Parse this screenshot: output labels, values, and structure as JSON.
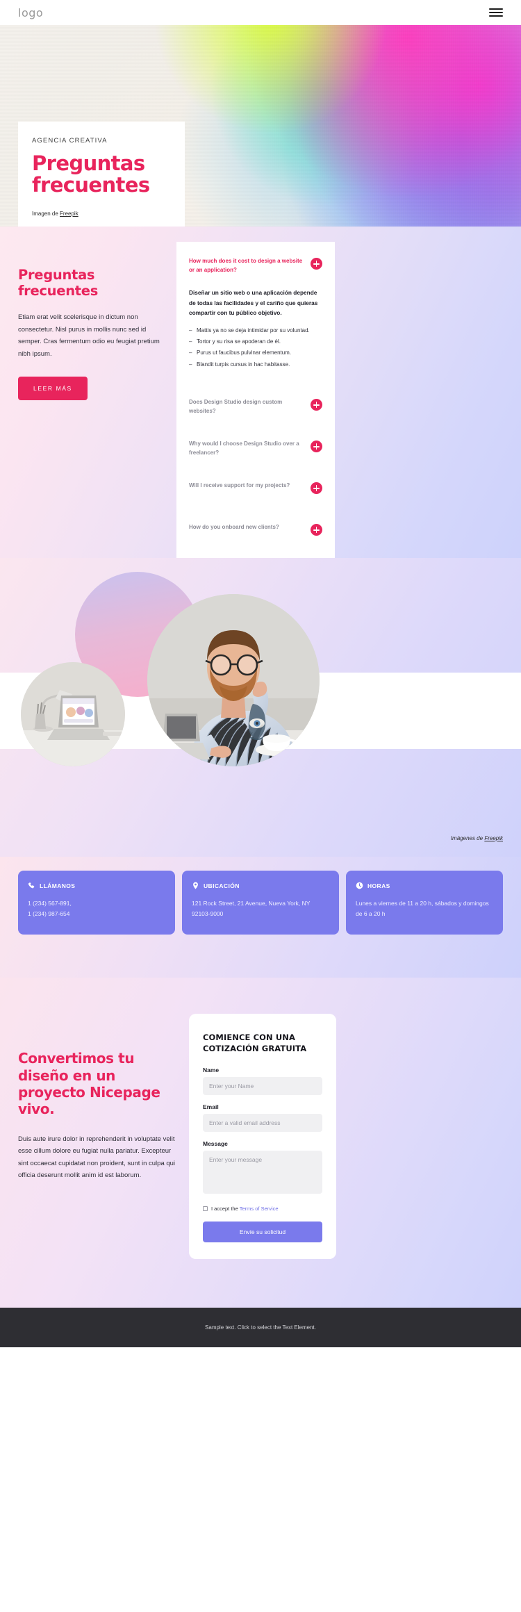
{
  "header": {
    "logo": "logo",
    "menu_icon": "hamburger-menu-icon"
  },
  "hero": {
    "eyebrow": "AGENCIA CREATIVA",
    "title_line1": "Preguntas",
    "title_line2": "frecuentes",
    "credit_prefix": "Imagen de ",
    "credit_link": "Freepik"
  },
  "faq": {
    "heading": "Preguntas frecuentes",
    "lead": "Etiam erat velit scelerisque in dictum non consectetur. Nisl purus in mollis nunc sed id semper. Cras fermentum odio eu feugiat pretium nibh ipsum.",
    "cta_label": "LEER MÁS",
    "items": [
      {
        "question": "How much does it cost to design a website or an application?",
        "open": true,
        "answer_lead": "Diseñar un sitio web o una aplicación depende de todas las facilidades y el cariño que quieras compartir con tu público objetivo.",
        "bullets": [
          "Mattis ya no se deja intimidar por su voluntad.",
          "Tortor y su risa se apoderan de él.",
          "Purus ut faucibus pulvinar elementum.",
          "Blandit turpis cursus in hac habitasse."
        ]
      },
      {
        "question": "Does Design Studio design custom websites?",
        "open": false
      },
      {
        "question": "Why would I choose Design Studio over a freelancer?",
        "open": false
      },
      {
        "question": "Will I receive support for my projects?",
        "open": false
      },
      {
        "question": "How do you onboard new clients?",
        "open": false
      }
    ]
  },
  "photos": {
    "credit_prefix": "Imágenes de ",
    "credit_link": "Freepik"
  },
  "contact": {
    "cards": [
      {
        "icon": "phone-icon",
        "title": "LLÁMANOS",
        "body": "1 (234) 567-891,\n1 (234) 987-654"
      },
      {
        "icon": "location-pin-icon",
        "title": "UBICACIÓN",
        "body": "121 Rock Street, 21 Avenue, Nueva York, NY 92103-9000"
      },
      {
        "icon": "clock-icon",
        "title": "HORAS",
        "body": "Lunes a viernes de 11 a 20 h, sábados y domingos de 6 a 20 h"
      }
    ]
  },
  "cta": {
    "title": "Convertimos tu diseño en un proyecto Nicepage vivo.",
    "text": "Duis aute irure dolor in reprehenderit in voluptate velit esse cillum dolore eu fugiat nulla pariatur. Excepteur sint occaecat cupidatat non proident, sunt in culpa qui officia deserunt mollit anim id est laborum."
  },
  "form": {
    "title": "COMIENCE CON UNA COTIZACIÓN GRATUITA",
    "name_label": "Name",
    "name_placeholder": "Enter your Name",
    "name_value": "",
    "email_label": "Email",
    "email_placeholder": "Enter a valid email address",
    "email_value": "",
    "message_label": "Message",
    "message_placeholder": "Enter your message",
    "message_value": "",
    "accept_prefix": "I accept the ",
    "accept_link": "Terms of Service",
    "submit_label": "Envíe su solicitud"
  },
  "footer": {
    "text": "Sample text. Click to select the Text Element."
  },
  "colors": {
    "accent_pink": "#e8245c",
    "accent_purple": "#7a7aec",
    "footer_bg": "#2e2e33"
  }
}
